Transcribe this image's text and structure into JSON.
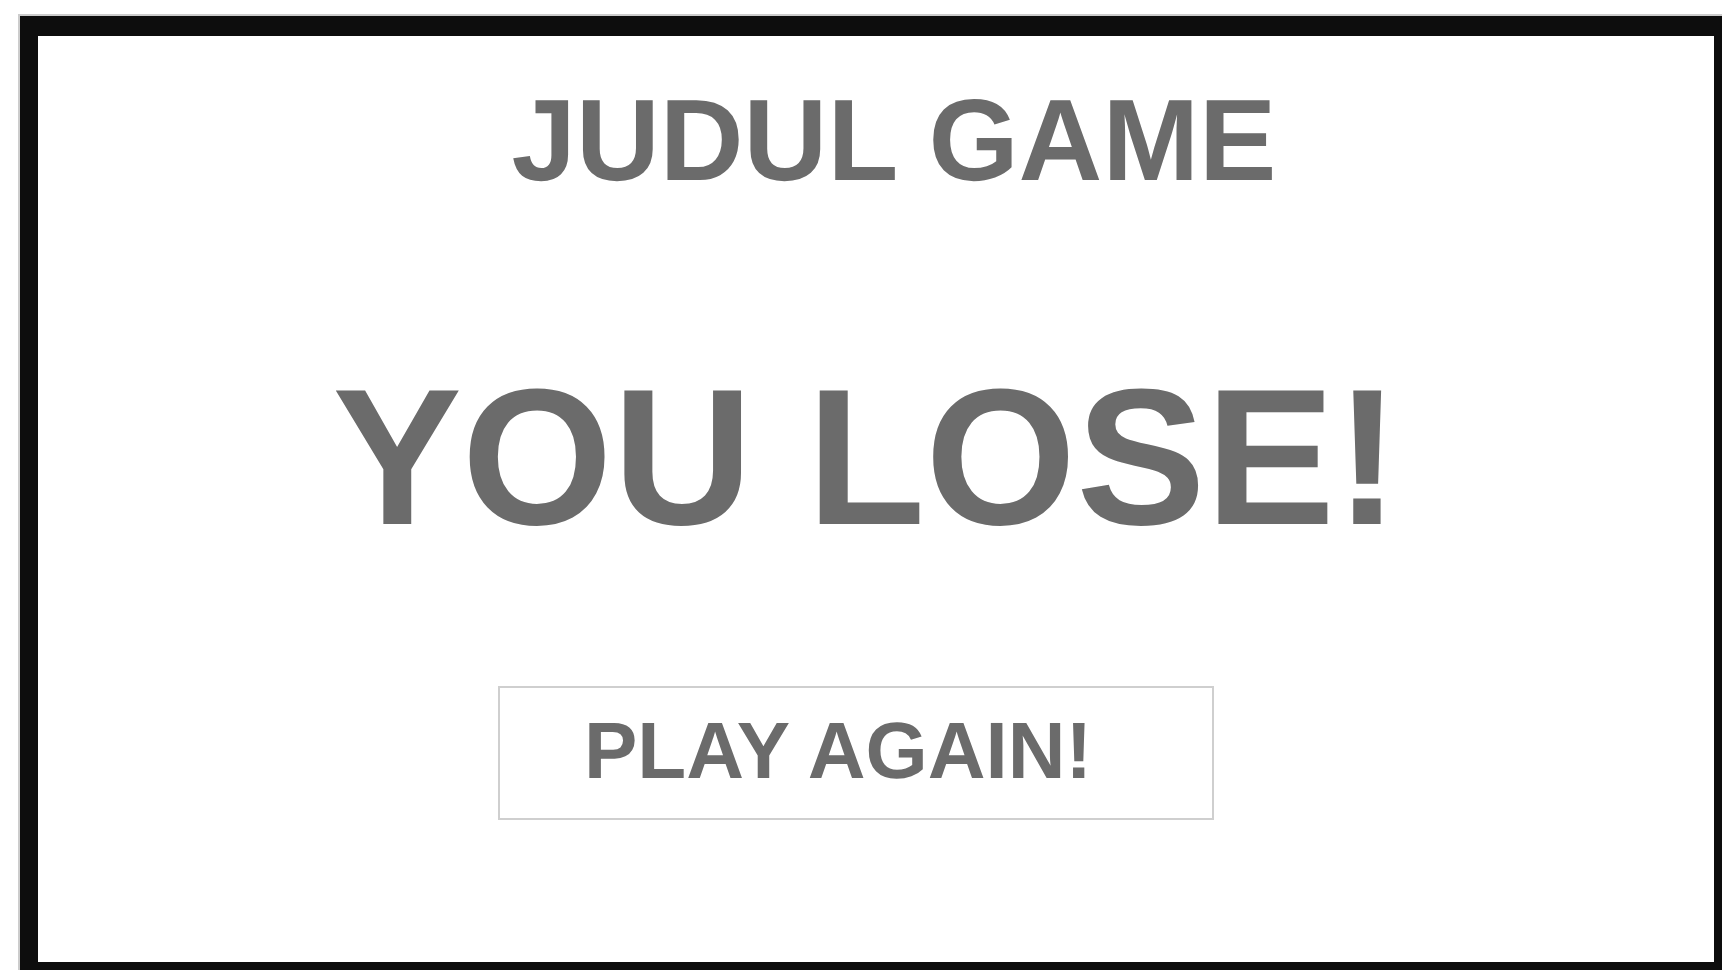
{
  "title": "JUDUL GAME",
  "message": "YOU LOSE!",
  "button": {
    "label": "PLAY AGAIN!"
  }
}
